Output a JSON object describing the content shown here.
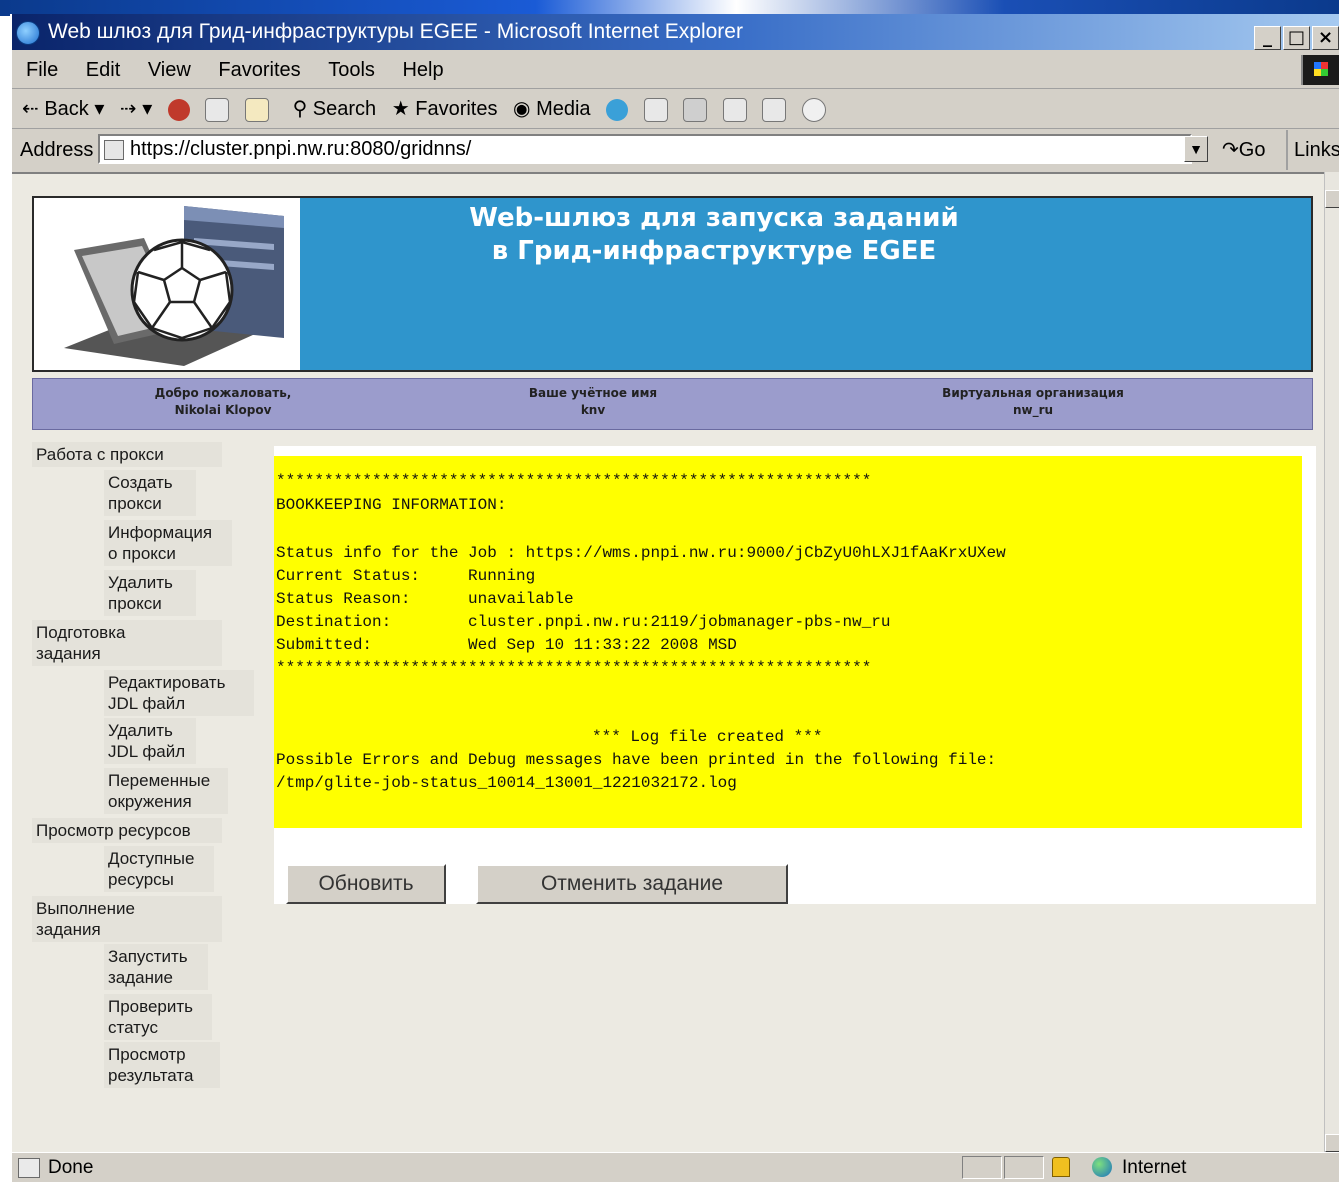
{
  "window": {
    "title": "Web шлюз для Грид-инфраструктуры EGEE - Microsoft Internet Explorer",
    "buttons": [
      "_",
      "□",
      "×"
    ]
  },
  "menu": {
    "items": [
      "File",
      "Edit",
      "View",
      "Favorites",
      "Tools",
      "Help"
    ]
  },
  "toolbar": {
    "back": "Back",
    "search": "Search",
    "favorites": "Favorites",
    "media": "Media"
  },
  "address": {
    "label": "Address",
    "url": "https://cluster.pnpi.nw.ru:8080/gridnns/",
    "go": "Go",
    "links": "Links"
  },
  "banner": {
    "line1": "Web-шлюз для запуска заданий",
    "line2": "в Грид-инфраструктуре EGEE"
  },
  "userbar": {
    "welcome_label": "Добро пожаловать,",
    "welcome_name": "Nikolai Klopov",
    "account_label": "Ваше учётное имя",
    "account_value": "knv",
    "vo_label": "Виртуальная организация",
    "vo_value": "nw_ru"
  },
  "sidebar": {
    "proxy_section": "Работа с прокси",
    "create_proxy": [
      "Создать",
      "прокси"
    ],
    "proxy_info": [
      "Информация",
      "о прокси"
    ],
    "delete_proxy": [
      "Удалить",
      "прокси"
    ],
    "job_prep_section": [
      "Подготовка",
      "задания"
    ],
    "edit_jdl": [
      "Редактировать",
      "JDL файл"
    ],
    "delete_jdl": [
      "Удалить",
      "JDL файл"
    ],
    "env_vars": [
      "Переменные",
      "окружения"
    ],
    "resources_section": "Просмотр ресурсов",
    "available_resources": [
      "Доступные",
      "ресурсы"
    ],
    "execution_section": [
      "Выполнение",
      "задания"
    ],
    "run_job": [
      "Запустить",
      "задание"
    ],
    "check_status": [
      "Проверить",
      "статус"
    ],
    "view_result": [
      "Просмотр",
      "результата"
    ]
  },
  "log": {
    "separator": "**************************************************************",
    "header": "BOOKKEEPING INFORMATION:",
    "status_line": "Status info for the Job : https://wms.pnpi.nw.ru:9000/jCbZyU0hLXJ1fAaKrxUXew",
    "current_status": "Current Status:     Running",
    "status_reason": "Status Reason:      unavailable",
    "destination": "Destination:        cluster.pnpi.nw.ru:2119/jobmanager-pbs-nw_ru",
    "submitted": "Submitted:          Wed Sep 10 11:33:22 2008 MSD",
    "log_created": "*** Log file created ***",
    "possible_errors": "Possible Errors and Debug messages have been printed in the following file:",
    "log_path": "/tmp/glite-job-status_10014_13001_1221032172.log"
  },
  "actions": {
    "refresh": "Обновить",
    "cancel_job": "Отменить задание"
  },
  "status": {
    "text": "Done",
    "zone": "Internet"
  }
}
